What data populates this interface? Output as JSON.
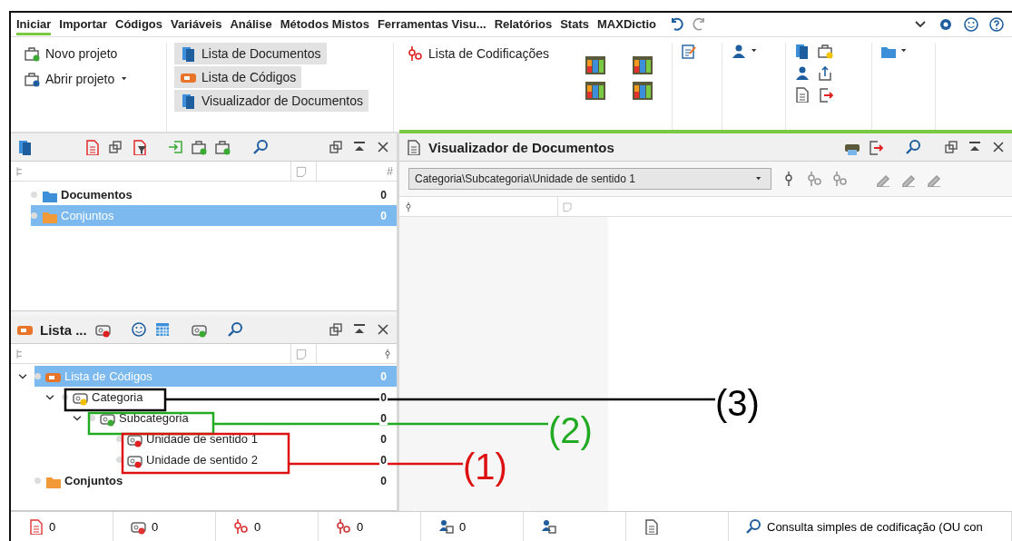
{
  "menu_tabs": [
    {
      "label": "Iniciar",
      "selected": true
    },
    {
      "label": "Importar",
      "selected": false
    },
    {
      "label": "Códigos",
      "selected": false
    },
    {
      "label": "Variáveis",
      "selected": false
    },
    {
      "label": "Análise",
      "selected": false
    },
    {
      "label": "Métodos Mistos",
      "selected": false
    },
    {
      "label": "Ferramentas Visu...",
      "selected": false
    },
    {
      "label": "Relatórios",
      "selected": false
    },
    {
      "label": "Stats",
      "selected": false
    },
    {
      "label": "MAXDictio",
      "selected": false
    }
  ],
  "ribbon": {
    "project_buttons": [
      {
        "label": "Novo projeto",
        "has_dropdown": false
      },
      {
        "label": "Abrir projeto",
        "has_dropdown": true
      }
    ],
    "view_buttons": [
      {
        "label": "Lista de Documentos",
        "on": true
      },
      {
        "label": "Lista de Códigos",
        "on": true
      },
      {
        "label": "Visualizador de Documentos",
        "on": true
      }
    ],
    "codings_button": {
      "label": "Lista de Codificações",
      "on": false
    }
  },
  "documents_panel": {
    "count_header": "#",
    "rows": [
      {
        "label": "Documentos",
        "count": "0",
        "selected": false,
        "bold": true,
        "kind": "documents"
      },
      {
        "label": "Conjuntos",
        "count": "0",
        "selected": true,
        "bold": false,
        "kind": "sets"
      }
    ]
  },
  "codes_panel": {
    "title": "Lista ...",
    "tree": [
      {
        "label": "Lista de Códigos",
        "count": "0",
        "selected": true,
        "expanded": true,
        "bold": false,
        "kind": "root",
        "children": [
          {
            "label": "Categoria",
            "count": "0",
            "selected": false,
            "expanded": true,
            "bold": false,
            "kind": "code",
            "color": "#f0c000",
            "children": [
              {
                "label": "Subcategoria",
                "count": "0",
                "selected": false,
                "expanded": true,
                "bold": false,
                "kind": "code",
                "color": "#3aaa35",
                "children": [
                  {
                    "label": "Unidade de sentido 1",
                    "count": "0",
                    "selected": false,
                    "bold": false,
                    "kind": "code",
                    "color": "#e02020"
                  },
                  {
                    "label": "Unidade de sentido 2",
                    "count": "0",
                    "selected": false,
                    "bold": false,
                    "kind": "code",
                    "color": "#e02020"
                  }
                ]
              }
            ]
          }
        ]
      },
      {
        "label": "Conjuntos",
        "count": "0",
        "selected": false,
        "bold": true,
        "kind": "sets"
      }
    ]
  },
  "viewer": {
    "title": "Visualizador de Documentos",
    "code_select": "Categoria\\Subcategoria\\Unidade de sentido 1"
  },
  "status_bar": [
    {
      "kind": "documents",
      "value": "0"
    },
    {
      "kind": "codes",
      "value": "0"
    },
    {
      "kind": "codings",
      "value": "0"
    },
    {
      "kind": "variables",
      "value": "0"
    },
    {
      "kind": "users",
      "value": "0"
    },
    {
      "kind": "user"
    },
    {
      "kind": "doc"
    },
    {
      "kind": "query",
      "value": "Consulta simples de codificação (OU con"
    }
  ],
  "annotations": [
    {
      "label": "(3)",
      "color": "#000000"
    },
    {
      "label": "(2)",
      "color": "#22aa22"
    },
    {
      "label": "(1)",
      "color": "#dd1111"
    }
  ]
}
